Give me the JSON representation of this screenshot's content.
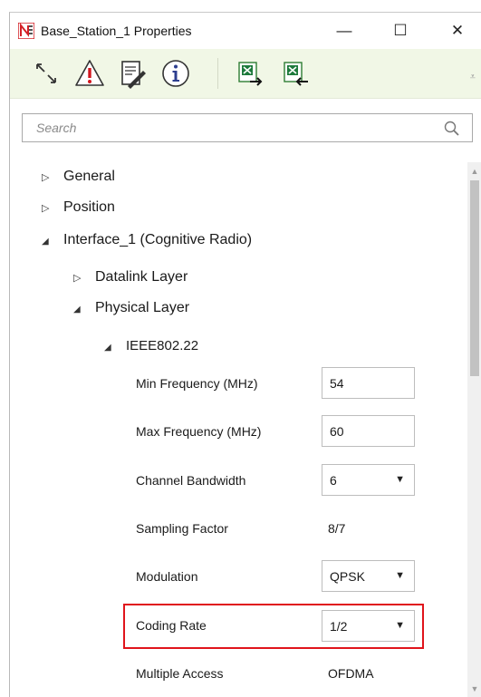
{
  "window": {
    "title": "Base_Station_1 Properties",
    "controls": {
      "minimize": "—",
      "maximize": "☐",
      "close": "✕"
    }
  },
  "toolbar": {
    "buttons": [
      {
        "name": "expand-arrows-icon"
      },
      {
        "name": "warning-icon"
      },
      {
        "name": "document-edit-icon"
      },
      {
        "name": "info-icon"
      },
      {
        "name": "excel-export-icon"
      },
      {
        "name": "excel-import-icon"
      }
    ],
    "overflow": "⩡"
  },
  "search": {
    "placeholder": "Search",
    "value": ""
  },
  "tree": {
    "nodes": {
      "general": {
        "arrow": "▷",
        "label": "General"
      },
      "position": {
        "arrow": "▷",
        "label": "Position"
      },
      "interface": {
        "arrow": "◢",
        "label": "Interface_1 (Cognitive Radio)"
      },
      "datalink": {
        "arrow": "▷",
        "label": "Datalink Layer"
      },
      "physical": {
        "arrow": "◢",
        "label": "Physical Layer"
      },
      "ieee": {
        "arrow": "◢",
        "label": "IEEE802.22"
      }
    }
  },
  "properties": {
    "min_frequency": {
      "label": "Min Frequency (MHz)",
      "value": "54"
    },
    "max_frequency": {
      "label": "Max Frequency (MHz)",
      "value": "60"
    },
    "channel_bandwidth": {
      "label": "Channel Bandwidth",
      "value": "6"
    },
    "sampling_factor": {
      "label": "Sampling Factor",
      "value": "8/7"
    },
    "modulation": {
      "label": "Modulation",
      "value": "QPSK"
    },
    "coding_rate": {
      "label": "Coding Rate",
      "value": "1/2"
    },
    "multiple_access": {
      "label": "Multiple Access",
      "value": "OFDMA"
    }
  },
  "dropdown_caret": "▼",
  "scrollbar": {
    "up": "▲",
    "down": "▼"
  },
  "colors": {
    "toolbar_bg": "#f1f7e6",
    "highlight": "#e0141b",
    "app_icon": "#d42027"
  }
}
